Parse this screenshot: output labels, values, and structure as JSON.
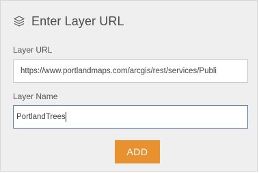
{
  "header": {
    "icon": "layers-icon",
    "title": "Enter Layer URL"
  },
  "form": {
    "layer_url": {
      "label": "Layer URL",
      "value": "https://www.portlandmaps.com/arcgis/rest/services/Publi"
    },
    "layer_name": {
      "label": "Layer Name",
      "value": "PortlandTrees"
    }
  },
  "actions": {
    "add_label": "ADD"
  },
  "colors": {
    "panel_background": "#efefef",
    "accent_button": "#e8912f",
    "focused_border": "#4e7eb2"
  }
}
